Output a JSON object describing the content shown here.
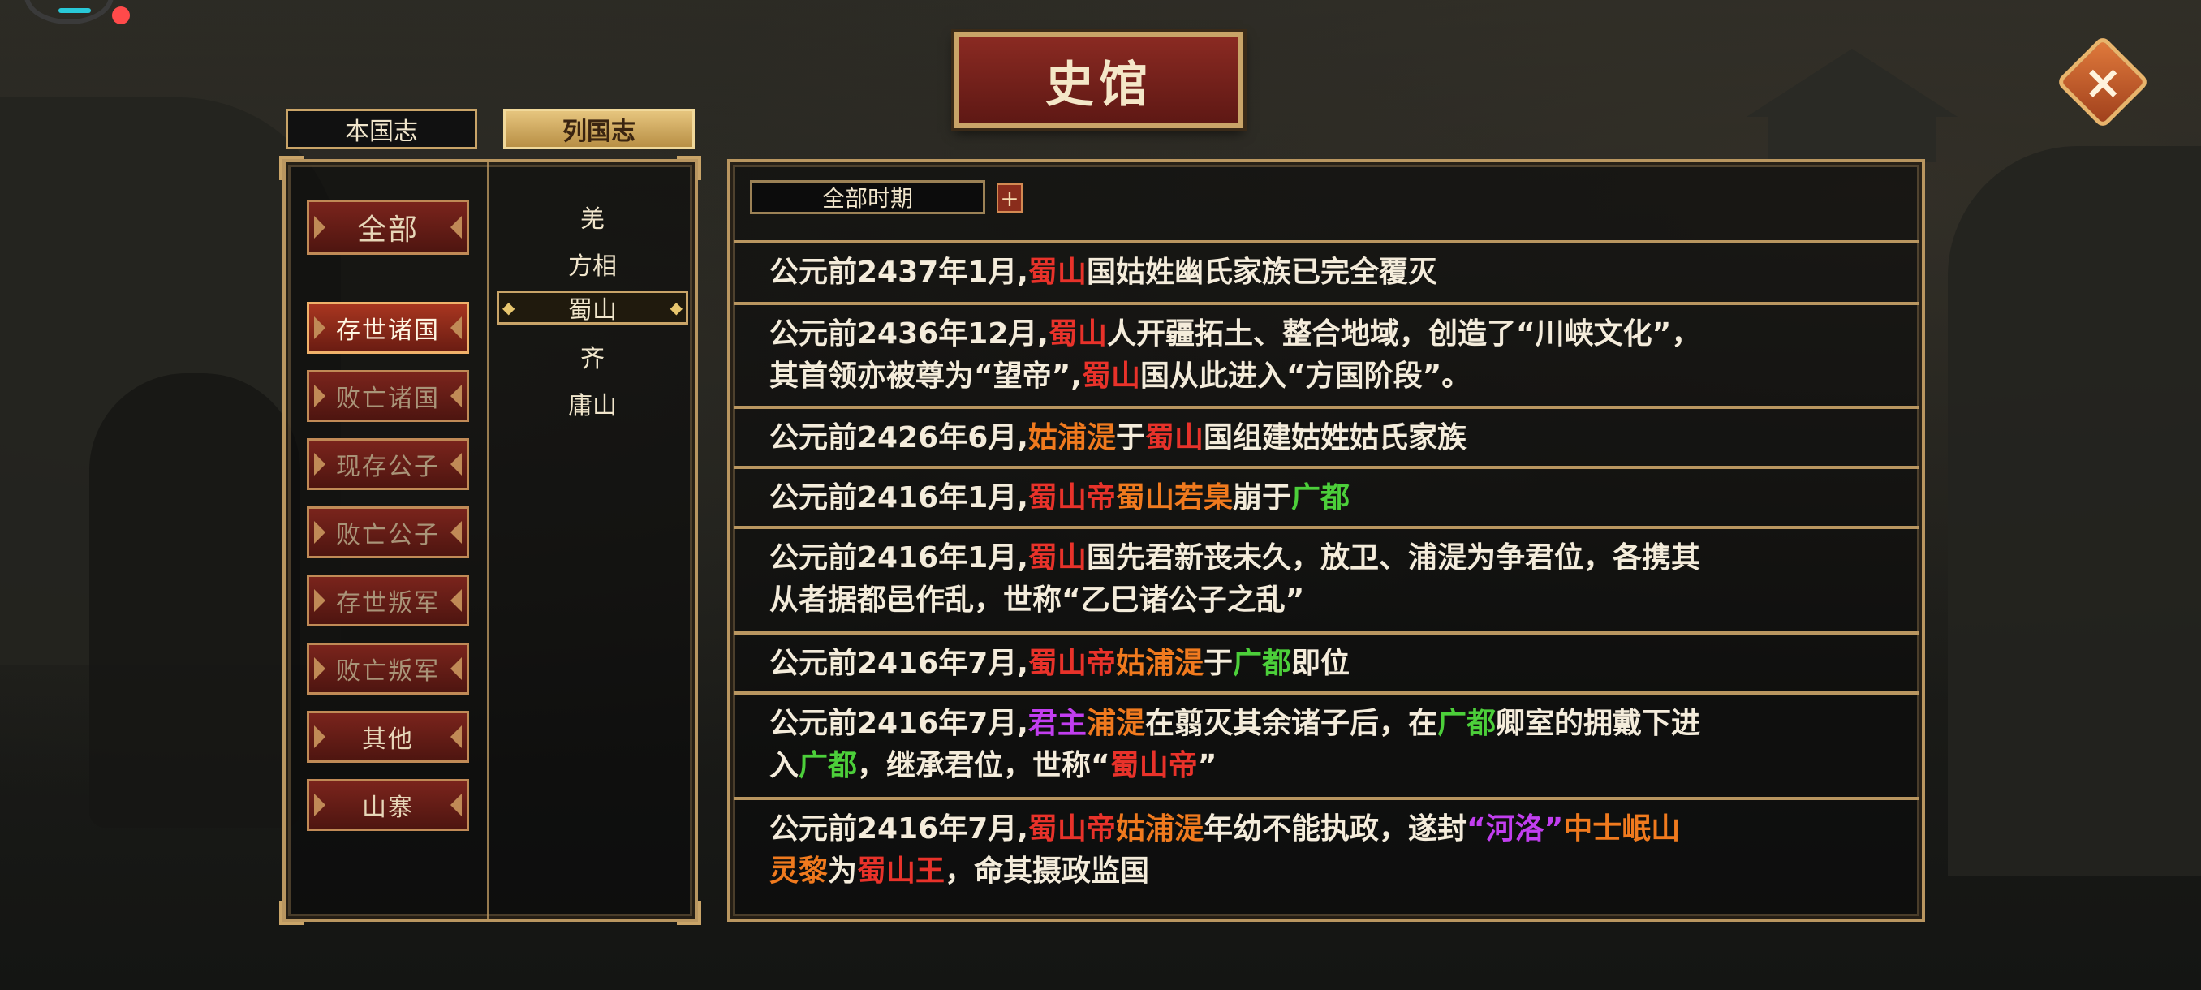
{
  "title": "史馆",
  "close_icon": "×",
  "tabs": {
    "benguo": "本国志",
    "lieguo": "列国志"
  },
  "categories": {
    "all": "全部",
    "items": [
      "存世诸国",
      "败亡诸国",
      "现存公子",
      "败亡公子",
      "存世叛军",
      "败亡叛军",
      "其他",
      "山寨"
    ]
  },
  "nations": [
    "羌",
    "方相",
    "蜀山",
    "齐",
    "庸山"
  ],
  "selected_nation": "蜀山",
  "period": {
    "label": "全部时期",
    "plus": "+"
  },
  "colors": {
    "nation_red": "#e8322a",
    "person_orange": "#f07a1e",
    "place_green": "#4ccf3a",
    "title_purple": "#c23ef0"
  },
  "entries": [
    {
      "lines": [
        [
          [
            "公元前2437年1月,",
            ""
          ],
          [
            "蜀山",
            "r"
          ],
          [
            "国姑姓幽氏家族已完全覆灭",
            ""
          ]
        ]
      ]
    },
    {
      "lines": [
        [
          [
            "公元前2436年12月,",
            ""
          ],
          [
            "蜀山",
            "r"
          ],
          [
            "人开疆拓土、整合地域，创造了“川峡文化”，",
            ""
          ]
        ],
        [
          [
            "其首领亦被尊为“望帝”,",
            ""
          ],
          [
            "蜀山",
            "r"
          ],
          [
            "国从此进入“方国阶段”。",
            ""
          ]
        ]
      ]
    },
    {
      "lines": [
        [
          [
            "公元前2426年6月,",
            ""
          ],
          [
            "姑浦湜",
            "o"
          ],
          [
            "于",
            ""
          ],
          [
            "蜀山",
            "r"
          ],
          [
            "国组建姑姓姑氏家族",
            ""
          ]
        ]
      ]
    },
    {
      "lines": [
        [
          [
            "公元前2416年1月,",
            ""
          ],
          [
            "蜀山帝",
            "r"
          ],
          [
            "蜀山若臬",
            "o"
          ],
          [
            "崩于",
            ""
          ],
          [
            "广都",
            "g"
          ]
        ]
      ]
    },
    {
      "lines": [
        [
          [
            "公元前2416年1月,",
            ""
          ],
          [
            "蜀山",
            "r"
          ],
          [
            "国先君新丧未久，放卫、浦湜为争君位，各携其",
            ""
          ]
        ],
        [
          [
            "从者据都邑作乱，世称“乙巳诸公子之乱”",
            ""
          ]
        ]
      ]
    },
    {
      "lines": [
        [
          [
            "公元前2416年7月,",
            ""
          ],
          [
            "蜀山帝",
            "r"
          ],
          [
            "姑浦湜",
            "o"
          ],
          [
            "于",
            ""
          ],
          [
            "广都",
            "g"
          ],
          [
            "即位",
            ""
          ]
        ]
      ]
    },
    {
      "lines": [
        [
          [
            "公元前2416年7月,",
            ""
          ],
          [
            "君主",
            "p"
          ],
          [
            "浦湜",
            "o"
          ],
          [
            "在翦灭其余诸子后，在",
            ""
          ],
          [
            "广都",
            "g"
          ],
          [
            "卿室的拥戴下进",
            ""
          ]
        ],
        [
          [
            "入",
            ""
          ],
          [
            "广都",
            "g"
          ],
          [
            "，继承君位，世称“",
            ""
          ],
          [
            "蜀山帝",
            "r"
          ],
          [
            "”",
            ""
          ]
        ]
      ]
    },
    {
      "lines": [
        [
          [
            "公元前2416年7月,",
            ""
          ],
          [
            "蜀山帝",
            "r"
          ],
          [
            "姑浦湜",
            "o"
          ],
          [
            "年幼不能执政，遂封",
            ""
          ],
          [
            "“河洛”",
            "p"
          ],
          [
            "中士岷山",
            "o"
          ]
        ],
        [
          [
            "灵黎",
            "o"
          ],
          [
            "为",
            ""
          ],
          [
            "蜀山王",
            "r"
          ],
          [
            "，命其摄政监国",
            ""
          ]
        ]
      ]
    }
  ]
}
